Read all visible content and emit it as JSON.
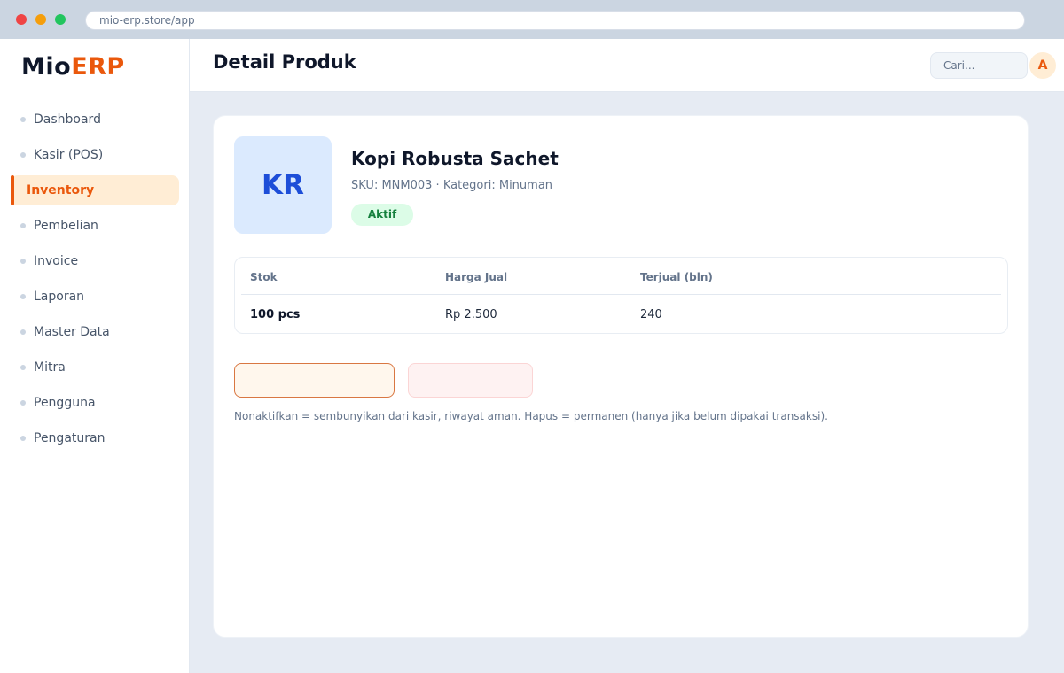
{
  "browser": {
    "url": "mio-erp.store/app"
  },
  "brand": {
    "name_part1": "Mio",
    "name_part2": "ERP"
  },
  "sidebar": {
    "items": [
      {
        "label": "Dashboard",
        "active": false
      },
      {
        "label": "Kasir (POS)",
        "active": false
      },
      {
        "label": "Inventory",
        "active": true
      },
      {
        "label": "Pembelian",
        "active": false
      },
      {
        "label": "Invoice",
        "active": false
      },
      {
        "label": "Laporan",
        "active": false
      },
      {
        "label": "Master Data",
        "active": false
      },
      {
        "label": "Mitra",
        "active": false
      },
      {
        "label": "Pengguna",
        "active": false
      },
      {
        "label": "Pengaturan",
        "active": false
      }
    ]
  },
  "header": {
    "title": "Detail Produk",
    "search_placeholder": "Cari...",
    "avatar_initial": "A"
  },
  "product": {
    "initials": "KR",
    "name": "Kopi Robusta Sachet",
    "meta": "SKU: MNM003 · Kategori: Minuman",
    "status": "Aktif",
    "stats": {
      "headers": [
        "Stok",
        "Harga Jual",
        "Terjual (bln)"
      ],
      "values": [
        "100 pcs",
        "Rp 2.500",
        "240"
      ]
    }
  },
  "actions": {
    "deactivate_label": "",
    "delete_label": ""
  },
  "note": "Nonaktifkan = sembunyikan dari kasir, riwayat aman. Hapus = permanen (hanya jika belum dipakai transaksi).",
  "colors": {
    "accent": "#ea580c",
    "thumb_bg": "#dbeafe",
    "thumb_text": "#1d4ed8",
    "status_bg": "#dcfce7",
    "status_text": "#15803d"
  }
}
